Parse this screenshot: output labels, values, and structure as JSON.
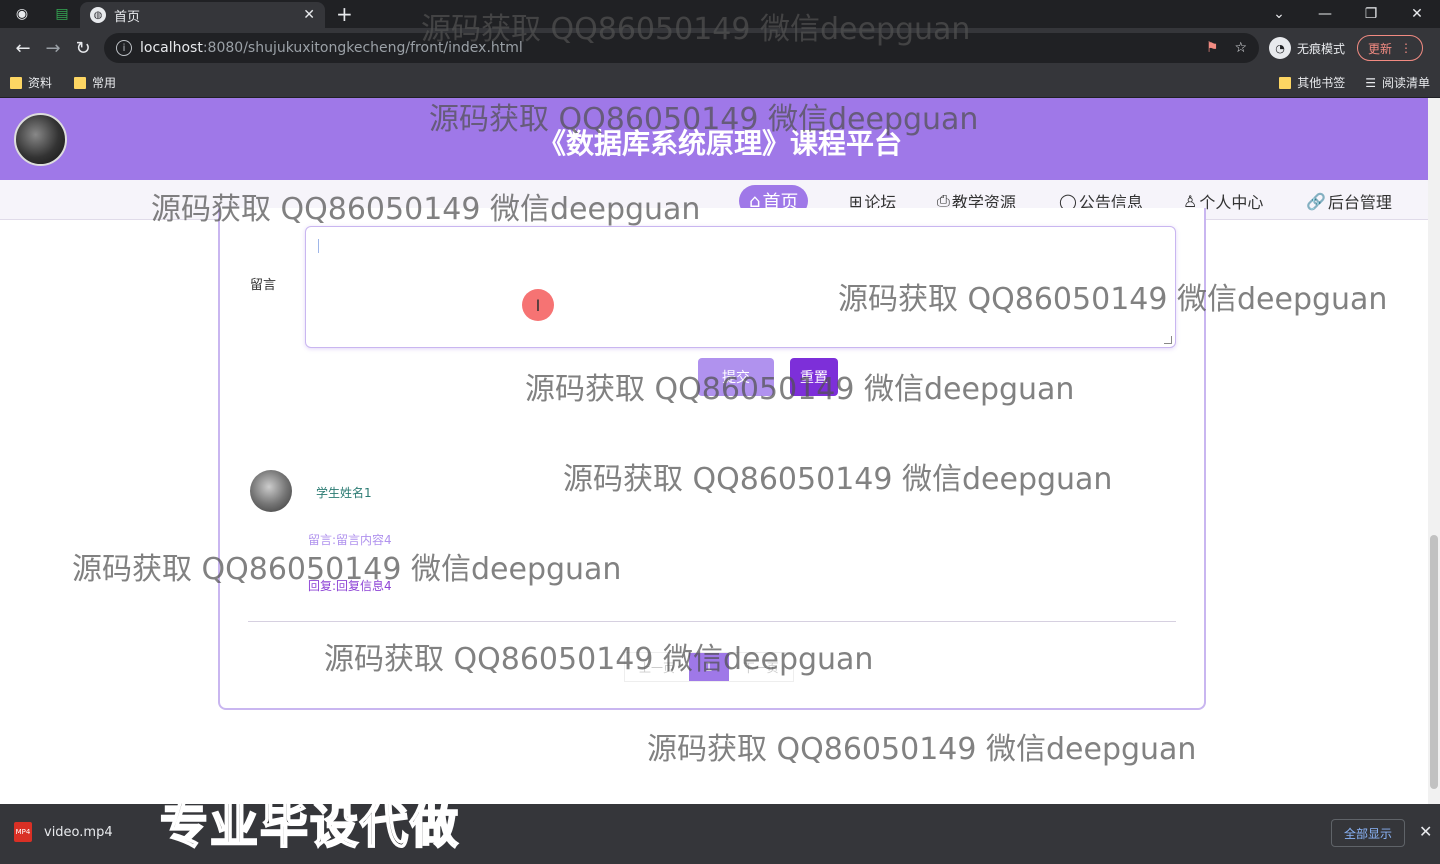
{
  "browser": {
    "tab_title": "首页",
    "tab_close": "✕",
    "new_tab": "+",
    "url_host": "localhost",
    "url_path": ":8080/shujukuxitongkecheng/front/index.html",
    "incognito_label": "无痕模式",
    "update_label": "更新",
    "bookmarks": [
      "资料",
      "常用"
    ],
    "other_bookmarks": "其他书签",
    "reading_list": "阅读清单"
  },
  "site": {
    "title": "《数据库系统原理》课程平台"
  },
  "nav": [
    {
      "icon": "⌂",
      "label": "首页"
    },
    {
      "icon": "⊞",
      "label": "论坛"
    },
    {
      "icon": "⎙",
      "label": "教学资源"
    },
    {
      "icon": "◯",
      "label": "公告信息"
    },
    {
      "icon": "♙",
      "label": "个人中心"
    },
    {
      "icon": "🔗",
      "label": "后台管理"
    }
  ],
  "form": {
    "message_label": "留言",
    "submit_label": "提交",
    "reset_label": "重置"
  },
  "comment": {
    "student_name": "学生姓名1",
    "message": "留言:留言内容4",
    "reply": "回复:回复信息4"
  },
  "pagination": {
    "prev": "上一页",
    "current": "1",
    "next": "下一页"
  },
  "download": {
    "file_name": "video.mp4",
    "file_type": "MP4",
    "show_all": "全部显示",
    "close": "✕"
  },
  "overlay": {
    "watermark": "源码获取 QQ86050149 微信deepguan",
    "caption": "专业毕设代做"
  },
  "colors": {
    "brand": "#9f78e8",
    "brand_dark": "#7d2fd9"
  }
}
